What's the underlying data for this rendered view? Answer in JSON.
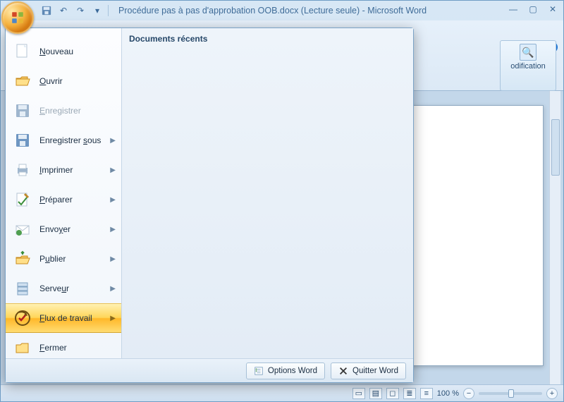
{
  "title": "Procédure pas à pas d'approbation OOB.docx (Lecture seule) - Microsoft Word",
  "ribbon": {
    "modification": "odification",
    "find": "⌕"
  },
  "menu": {
    "recent_header": "Documents récents",
    "items": {
      "new_lead": "N",
      "new_rest": "ouveau",
      "open_lead": "O",
      "open_rest": "uvrir",
      "save_lead": "E",
      "save_rest": "nregistrer",
      "saveas_pre": "Enregistrer ",
      "saveas_lead": "s",
      "saveas_post": "ous",
      "print_lead": "I",
      "print_rest": "mprimer",
      "prepare_lead": "P",
      "prepare_rest": "réparer",
      "send_pre": "Envo",
      "send_lead": "y",
      "send_post": "er",
      "publish_pre": "P",
      "publish_lead": "u",
      "publish_post": "blier",
      "server_pre": "Serve",
      "server_lead": "u",
      "server_post": "r",
      "workflow_lead": "F",
      "workflow_rest": "lux de travail",
      "close_lead": "F",
      "close_rest": "ermer"
    },
    "footer": {
      "options": "Options Word",
      "exit": "Quitter Word"
    }
  },
  "statusbar": {
    "zoom": "100 %"
  }
}
